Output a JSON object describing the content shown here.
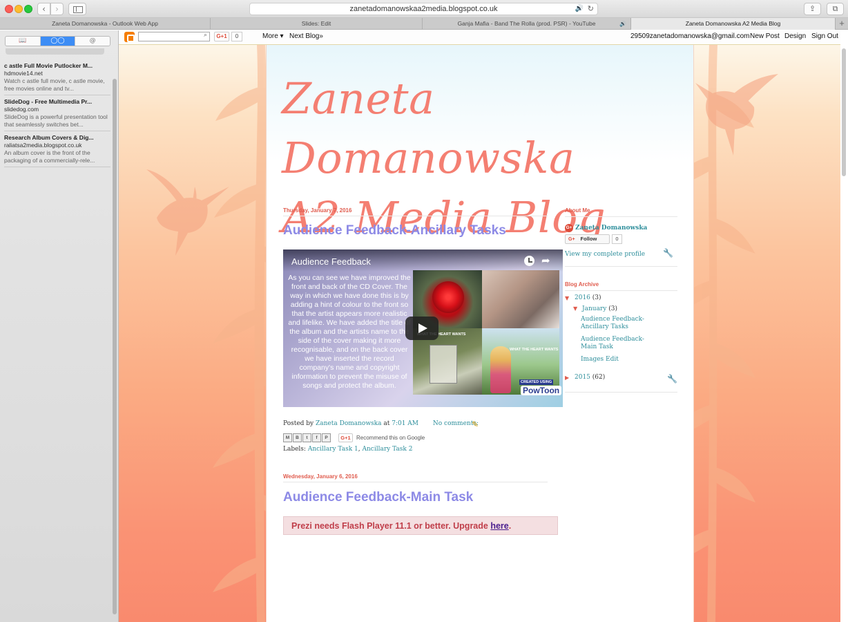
{
  "browser": {
    "url": "zanetadomanowskaa2media.blogspot.co.uk",
    "tabs": [
      {
        "label": "Zaneta Domanowska - Outlook Web App"
      },
      {
        "label": "Slides: Edit"
      },
      {
        "label": "Ganja Mafia - Band The Rolla (prod. PSR) - YouTube"
      },
      {
        "label": "Zaneta Domanowska A2 Media Blog"
      }
    ],
    "new_tab_label": "+"
  },
  "reading_list": {
    "items": [
      {
        "title": "c astle Full Movie Putlocker M...",
        "domain": "hdmovie14.net",
        "desc": "Watch c astle full movie, c astle movie, free movies online and tv..."
      },
      {
        "title": "SlideDog - Free Multimedia Pr...",
        "domain": "slidedog.com",
        "desc": "SlideDog is a powerful presentation tool that seamlessly switches bet..."
      },
      {
        "title": "Research Album Covers & Dig...",
        "domain": "raliatsa2media.blogspot.co.uk",
        "desc": "An album cover is the front of the packaging of a commercially-rele..."
      }
    ]
  },
  "navbar": {
    "gplus_label": "G+1",
    "gplus_count": "0",
    "more": "More ▾",
    "next_blog": "Next Blog»",
    "email": "29509zanetadomanowska@gmail.com",
    "new_post": "New Post",
    "design": "Design",
    "sign_out": "Sign Out"
  },
  "blog": {
    "title_line1": "Zaneta Domanowska",
    "title_line2": "A2 Media Blog"
  },
  "posts": [
    {
      "date": "Thursday, January 7, 2016",
      "title": "Audience Feedback-Ancillary Tasks",
      "video": {
        "title": "Audience Feedback",
        "text": "As you can see we have improved the front and back of the CD Cover. The way in which we have done this is by adding a hint of colour to the front so that the artist appears more realistic and lifelike. We have added the title of the album and the artists name to the side of the cover making it more recognisable, and on the back cover we have inserted the record company's name and copyright information to prevent the misuse of songs and protect the album.",
        "collage_label_1": "WHAT THE HEART WANTS",
        "collage_label_2": "WHAT THE HEART WANTS",
        "powtoon_sub": "CREATED USING",
        "powtoon_main": "PowToon"
      },
      "posted_by_label": "Posted by",
      "author": "Zaneta Domanowska",
      "at_label": "at",
      "time": "7:01 AM",
      "comments": "No comments:",
      "share_icons": [
        "M",
        "B",
        "t",
        "f",
        "P"
      ],
      "share_gplus": "G+1",
      "recommend": "Recommend this on Google",
      "labels_label": "Labels:",
      "label_1": "Ancillary Task 1",
      "label_sep": ",",
      "label_2": "Ancillary Task 2"
    },
    {
      "date": "Wednesday, January 6, 2016",
      "title": "Audience Feedback-Main Task",
      "prezi_text": "Prezi needs Flash Player 11.1 or better. Upgrade ",
      "prezi_link": "here",
      "prezi_end": "."
    }
  ],
  "sidebar": {
    "about_title": "About Me",
    "profile_badge": "G+",
    "profile_name": "Zaneta Domanowska",
    "follow_label": "Follow",
    "follow_g": "G+",
    "follow_count": "0",
    "view_profile": "View my complete profile",
    "archive_title": "Blog Archive",
    "archive": {
      "year_2016": "2016",
      "year_2016_count": "(3)",
      "month_january": "January",
      "month_january_count": "(3)",
      "posts": [
        "Audience Feedback-Ancillary Tasks",
        "Audience Feedback-Main Task",
        "Images Edit"
      ],
      "year_2015": "2015",
      "year_2015_count": "(62)"
    }
  },
  "colors": {
    "accent_title": "#f47f72",
    "post_title": "#8d8ae6",
    "link": "#2f8f9c",
    "date_header": "#e05c4e"
  }
}
